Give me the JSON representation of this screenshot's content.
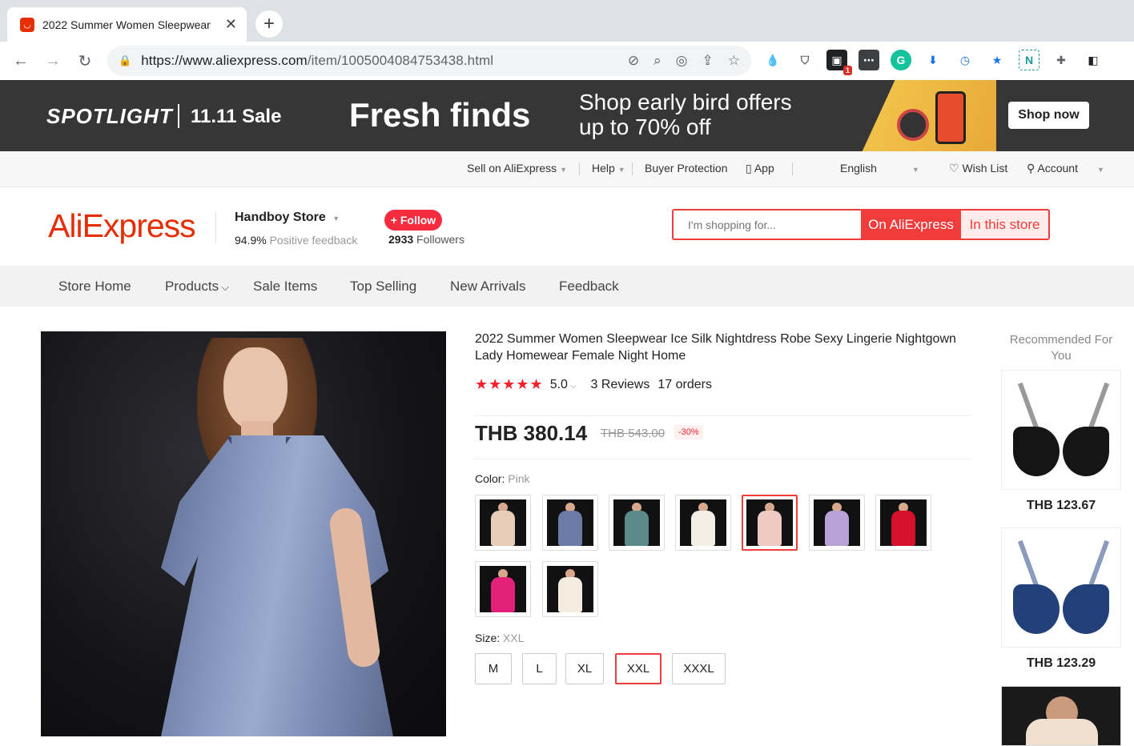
{
  "browser": {
    "tab_title": "2022 Summer Women Sleepwear",
    "tab_close": "✕",
    "new_tab": "+",
    "url_main": "https://www.aliexpress.com",
    "url_path": "/item/1005004084753438.html",
    "ext_badge": "1"
  },
  "banner": {
    "spotlight": "SPOTLIGHT",
    "sale": "11.11 Sale",
    "fresh": "Fresh finds",
    "offer_line1": "Shop early bird offers",
    "offer_line2": "up to 70% off",
    "shop_now": "Shop now"
  },
  "toplinks": {
    "sell": "Sell on AliExpress",
    "help": "Help",
    "buyer_protection": "Buyer Protection",
    "app": "App",
    "language": "English",
    "wishlist": "Wish List",
    "account": "Account"
  },
  "store": {
    "logo": "AliExpress",
    "name": "Handboy Store",
    "feedback_pct": "94.9%",
    "feedback_label": "Positive feedback",
    "follow": "+ Follow",
    "followers_count": "2933",
    "followers_label": "Followers",
    "search_placeholder": "I'm shopping for...",
    "search_on": "On AliExpress",
    "search_store": "In this store"
  },
  "store_nav": [
    "Store Home",
    "Products",
    "Sale Items",
    "Top Selling",
    "New Arrivals",
    "Feedback"
  ],
  "product": {
    "title": "2022 Summer Women Sleepwear Ice Silk Nightdress Robe Sexy Lingerie Nightgown Lady Homewear Female Night Home",
    "stars": "★★★★★",
    "rating": "5.0",
    "reviews": "3 Reviews",
    "orders": "17 orders",
    "price": "THB 380.14",
    "old_price": "THB 543.00",
    "discount": "-30%",
    "color_label": "Color:",
    "color_value": "Pink",
    "colors": [
      {
        "color": "#e8cdb8",
        "selected": false
      },
      {
        "color": "#6b7aa6",
        "selected": false
      },
      {
        "color": "#5c8a8a",
        "selected": false
      },
      {
        "color": "#f3eee6",
        "selected": false
      },
      {
        "color": "#efc9c4",
        "selected": true
      },
      {
        "color": "#b7a2d6",
        "selected": false
      },
      {
        "color": "#d4102a",
        "selected": false
      },
      {
        "color": "#e3207a",
        "selected": false
      },
      {
        "color": "#f5ece0",
        "selected": false
      }
    ],
    "size_label": "Size:",
    "size_value": "XXL",
    "sizes": [
      "M",
      "L",
      "XL",
      "XXL",
      "XXXL"
    ],
    "selected_size": "XXL"
  },
  "recommended": {
    "title": "Recommended For You",
    "items": [
      {
        "price": "THB 123.67",
        "color": "#151515"
      },
      {
        "price": "THB 123.29",
        "color": "#22407a"
      }
    ]
  },
  "colors": {
    "accent": "#f23b3b",
    "banner_bg": "#363636",
    "star": "#f5222d"
  }
}
